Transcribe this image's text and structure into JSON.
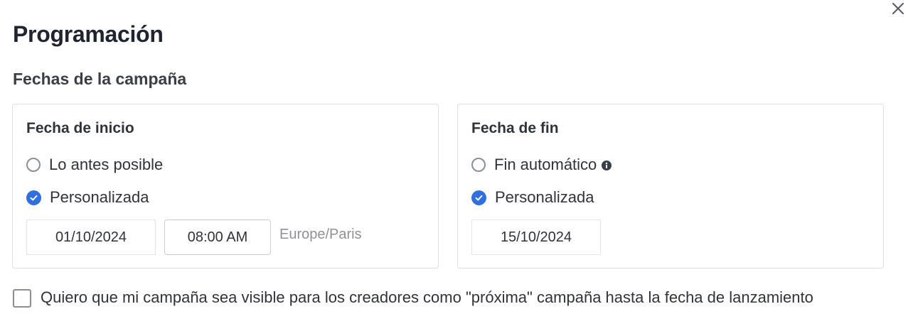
{
  "dialog": {
    "title": "Programación",
    "close_icon": "close-icon"
  },
  "campaign_dates": {
    "heading": "Fechas de la campaña",
    "start": {
      "title": "Fecha de inicio",
      "options": [
        {
          "label": "Lo antes posible",
          "selected": false
        },
        {
          "label": "Personalizada",
          "selected": true
        }
      ],
      "date": "01/10/2024",
      "time": "08:00 AM",
      "timezone": "Europe/Paris"
    },
    "end": {
      "title": "Fecha de fin",
      "options": [
        {
          "label": "Fin automático",
          "selected": false,
          "info_icon": "info-icon"
        },
        {
          "label": "Personalizada",
          "selected": true
        }
      ],
      "date": "15/10/2024"
    }
  },
  "upcoming_checkbox": {
    "label": "Quiero que mi campaña sea visible para los creadores como \"próxima\" campaña hasta la fecha de lanzamiento",
    "checked": false
  },
  "colors": {
    "accent": "#2f6fe0",
    "border": "#dcdfe3",
    "text": "#2f333a",
    "muted": "#8d9198"
  }
}
